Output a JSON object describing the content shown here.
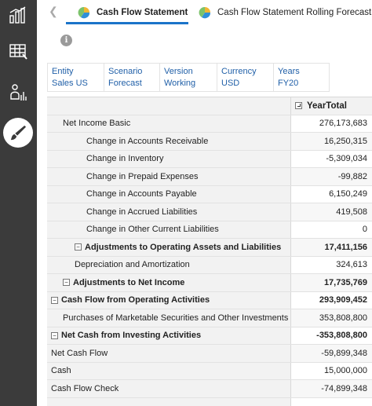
{
  "sidebar": {
    "items": [
      {
        "name": "dashboard-chart-icon"
      },
      {
        "name": "data-grid-icon"
      },
      {
        "name": "people-analytics-icon"
      },
      {
        "name": "brush-icon"
      }
    ]
  },
  "tabs": [
    {
      "label": "Cash Flow Statement",
      "active": true
    },
    {
      "label": "Cash Flow Statement Rolling Forecast",
      "active": false
    }
  ],
  "info": {
    "glyph": "i"
  },
  "pov": [
    {
      "dimension": "Entity",
      "member": "Sales US"
    },
    {
      "dimension": "Scenario",
      "member": "Forecast"
    },
    {
      "dimension": "Version",
      "member": "Working"
    },
    {
      "dimension": "Currency",
      "member": "USD"
    },
    {
      "dimension": "Years",
      "member": "FY20"
    }
  ],
  "grid": {
    "column_header": "YearTotal",
    "rows": [
      {
        "label": "Net Income Basic",
        "value": "276,173,683",
        "indent": 1,
        "bold": false,
        "toggle": ""
      },
      {
        "label": "Change in Accounts Receivable",
        "value": "16,250,315",
        "indent": 3,
        "bold": false,
        "toggle": ""
      },
      {
        "label": "Change in Inventory",
        "value": "-5,309,034",
        "indent": 3,
        "bold": false,
        "toggle": ""
      },
      {
        "label": "Change in Prepaid Expenses",
        "value": "-99,882",
        "indent": 3,
        "bold": false,
        "toggle": ""
      },
      {
        "label": "Change in Accounts Payable",
        "value": "6,150,249",
        "indent": 3,
        "bold": false,
        "toggle": ""
      },
      {
        "label": "Change in Accrued Liabilities",
        "value": "419,508",
        "indent": 3,
        "bold": false,
        "toggle": ""
      },
      {
        "label": "Change in Other Current Liabilities",
        "value": "0",
        "indent": 3,
        "bold": false,
        "toggle": ""
      },
      {
        "label": "Adjustments to Operating Assets and Liabilities",
        "value": "17,411,156",
        "indent": 2,
        "bold": true,
        "toggle": "−"
      },
      {
        "label": "Depreciation and Amortization",
        "value": "324,613",
        "indent": 2,
        "bold": false,
        "toggle": ""
      },
      {
        "label": "Adjustments to Net Income",
        "value": "17,735,769",
        "indent": 1,
        "bold": true,
        "toggle": "−"
      },
      {
        "label": "Cash Flow from Operating Activities",
        "value": "293,909,452",
        "indent": 0,
        "bold": true,
        "toggle": "−"
      },
      {
        "label": "Purchases of Marketable Securities and Other Investments",
        "value": "353,808,800",
        "indent": 1,
        "bold": false,
        "toggle": ""
      },
      {
        "label": "Net Cash from Investing Activities",
        "value": "-353,808,800",
        "indent": 0,
        "bold": true,
        "toggle": "−"
      },
      {
        "label": "Net Cash Flow",
        "value": "-59,899,348",
        "indent": 0,
        "bold": false,
        "toggle": ""
      },
      {
        "label": "Cash",
        "value": "15,000,000",
        "indent": 0,
        "bold": false,
        "toggle": ""
      },
      {
        "label": "Cash Flow Check",
        "value": "-74,899,348",
        "indent": 0,
        "bold": false,
        "toggle": ""
      },
      {
        "label": "",
        "value": "",
        "indent": 0,
        "bold": false,
        "toggle": ""
      }
    ]
  }
}
